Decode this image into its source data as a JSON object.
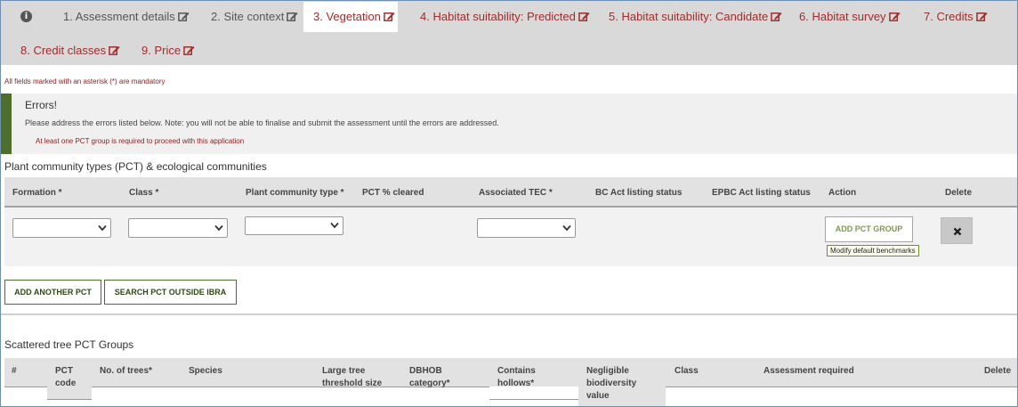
{
  "tabs": [
    {
      "label": "1. Assessment details",
      "state": "grey"
    },
    {
      "label": "2. Site context",
      "state": "grey"
    },
    {
      "label": "3. Vegetation",
      "state": "active"
    },
    {
      "label": "4. Habitat suitability: Predicted",
      "state": "red"
    },
    {
      "label": "5. Habitat suitability: Candidate",
      "state": "red"
    },
    {
      "label": "6. Habitat survey",
      "state": "red"
    },
    {
      "label": "7. Credits",
      "state": "red"
    },
    {
      "label": "8. Credit classes",
      "state": "red"
    },
    {
      "label": "9. Price",
      "state": "red"
    }
  ],
  "info_icon": "i",
  "mandatory_note": "All fields marked with an asterisk (*) are mandatory",
  "errors": {
    "title": "Errors!",
    "description": "Please address the errors listed below. Note: you will not be able to finalise and submit the assessment until the errors are addressed.",
    "items": [
      "At least one PCT group is required to proceed with this application"
    ]
  },
  "pct": {
    "section_title": "Plant community types (PCT) & ecological communities",
    "columns": [
      "Formation *",
      "Class *",
      "Plant community type *",
      "PCT % cleared",
      "Associated TEC *",
      "BC Act listing status",
      "EPBC Act listing status",
      "Action",
      "Delete"
    ],
    "add_group_label": "ADD PCT GROUP",
    "tooltip": "Modify default benchmarks",
    "delete_icon": "close-icon",
    "add_another_label": "ADD ANOTHER PCT",
    "search_outside_label": "SEARCH PCT OUTSIDE IBRA"
  },
  "scattered": {
    "section_title": "Scattered tree PCT Groups",
    "columns": [
      "#",
      "PCT code",
      "No. of trees*",
      "Species",
      "Large tree threshold size",
      "DBHOB category*",
      "Contains hollows*",
      "Negligible biodiversity value",
      "Class",
      "Assessment required",
      "Delete"
    ]
  },
  "colors": {
    "tab_bar": "#d9d9d9",
    "tab_text_red": "#a32a2a",
    "error_bar": "#4e6f2b",
    "button_border": "#4e6f2b"
  }
}
